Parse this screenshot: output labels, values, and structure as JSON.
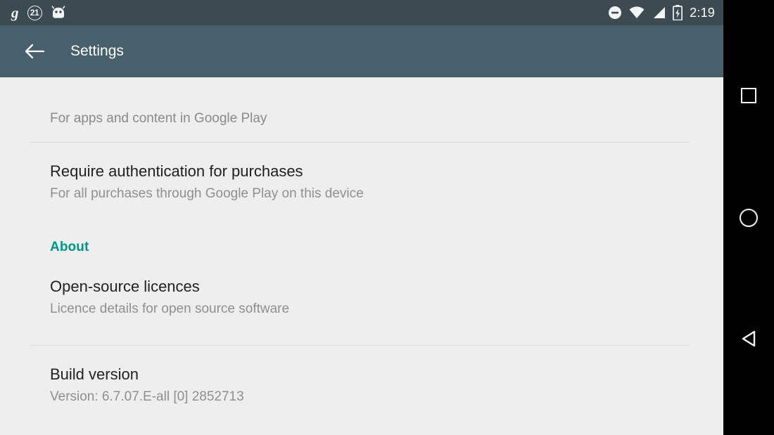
{
  "status_bar": {
    "notification_icons": [
      {
        "name": "google-notification-icon",
        "glyph": "g"
      },
      {
        "name": "notification-count-badge",
        "glyph": "21"
      },
      {
        "name": "android-robot-icon",
        "glyph": ""
      }
    ],
    "badge_count": "21",
    "dnd_icon": "do-not-disturb-icon",
    "wifi_icon": "wifi-icon",
    "signal_icon": "cellular-signal-icon",
    "battery_icon": "battery-charging-icon",
    "clock": "2:19",
    "background_color": "#3c4a52"
  },
  "app_bar": {
    "back_label": "back-arrow",
    "title": "Settings",
    "background_color": "#47606b"
  },
  "content": {
    "caption": "For apps and content in Google Play",
    "preferences": [
      {
        "title": "Require authentication for purchases",
        "summary": "For all purchases through Google Play on this device"
      }
    ],
    "section": {
      "header": "About",
      "header_color": "#009688",
      "items": [
        {
          "title": "Open-source licences",
          "summary": "Licence details for open source software"
        },
        {
          "title": "Build version",
          "summary": "Version: 6.7.07.E-all [0] 2852713"
        }
      ]
    },
    "background_color": "#eeeeee"
  },
  "nav_bar": {
    "recents_label": "recents-square",
    "home_label": "home-circle",
    "back_label": "back-triangle",
    "background_color": "#000000"
  }
}
